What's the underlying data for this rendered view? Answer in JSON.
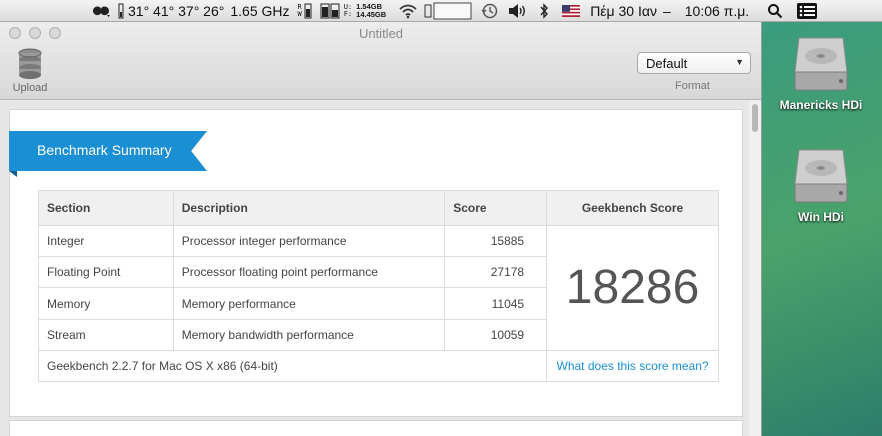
{
  "menubar": {
    "temps": "31° 41° 37° 26°",
    "cpu": "1.65 GHz",
    "disk_r": "R",
    "disk_w": "W",
    "mem_used_label": "U:",
    "mem_free_label": "F:",
    "mem_used": "1.54GB",
    "mem_free": "14.45GB",
    "date": "Πέμ 30 Ιαν",
    "sep": "–",
    "time": "10:06 π.μ."
  },
  "window": {
    "title": "Untitled",
    "upload_label": "Upload",
    "format_value": "Default",
    "format_label": "Format"
  },
  "banner": "Benchmark Summary",
  "table": {
    "headers": [
      "Section",
      "Description",
      "Score",
      "Geekbench Score"
    ],
    "rows": [
      {
        "section": "Integer",
        "description": "Processor integer performance",
        "score": "15885"
      },
      {
        "section": "Floating Point",
        "description": "Processor floating point performance",
        "score": "27178"
      },
      {
        "section": "Memory",
        "description": "Memory performance",
        "score": "11045"
      },
      {
        "section": "Stream",
        "description": "Memory bandwidth performance",
        "score": "10059"
      }
    ],
    "geekbench_score": "18286",
    "footer_text": "Geekbench 2.2.7 for Mac OS X x86 (64-bit)",
    "footer_link": "What does this score mean?"
  },
  "desktop": {
    "drive1": "Manericks HDi",
    "drive2": "Win HDi"
  },
  "colors": {
    "accent": "#1a8fd4"
  }
}
